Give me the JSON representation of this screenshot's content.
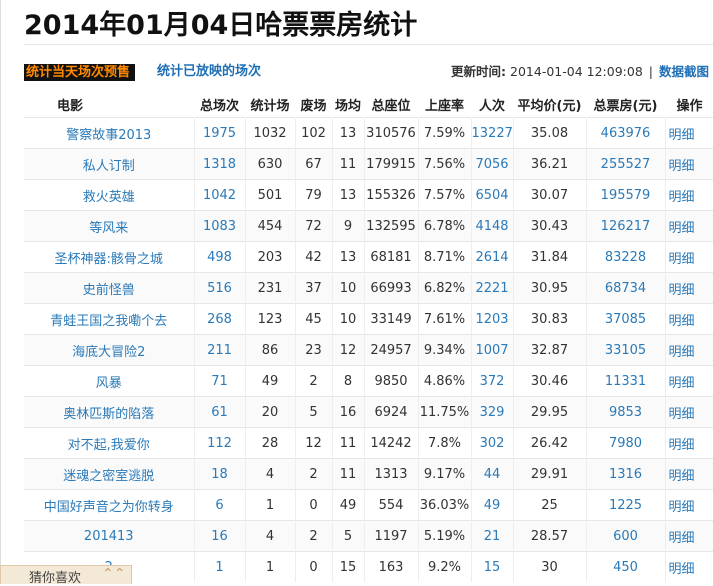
{
  "page": {
    "title": "2014年01月04日哈票票房统计"
  },
  "tabs": {
    "active": "统计当天场次预售",
    "other": "统计已放映的场次"
  },
  "update": {
    "label": "更新时间:",
    "time": "2014-01-04 12:09:08",
    "separator": "|",
    "screenshot_link": "数据截图"
  },
  "table": {
    "headers": [
      "电影",
      "总场次",
      "统计场",
      "废场",
      "场均",
      "总座位",
      "上座率",
      "人次",
      "平均价(元)",
      "总票房(元)",
      "操作"
    ],
    "rows": [
      [
        "警察故事2013",
        "1975",
        "1032",
        "102",
        "13",
        "310576",
        "7.59%",
        "13227",
        "35.08",
        "463976",
        "明细"
      ],
      [
        "私人订制",
        "1318",
        "630",
        "67",
        "11",
        "179915",
        "7.56%",
        "7056",
        "36.21",
        "255527",
        "明细"
      ],
      [
        "救火英雄",
        "1042",
        "501",
        "79",
        "13",
        "155326",
        "7.57%",
        "6504",
        "30.07",
        "195579",
        "明细"
      ],
      [
        "等风来",
        "1083",
        "454",
        "72",
        "9",
        "132595",
        "6.78%",
        "4148",
        "30.43",
        "126217",
        "明细"
      ],
      [
        "圣杯神器:骸骨之城",
        "498",
        "203",
        "42",
        "13",
        "68181",
        "8.71%",
        "2614",
        "31.84",
        "83228",
        "明细"
      ],
      [
        "史前怪兽",
        "516",
        "231",
        "37",
        "10",
        "66993",
        "6.82%",
        "2221",
        "30.95",
        "68734",
        "明细"
      ],
      [
        "青蛙王国之我嘞个去",
        "268",
        "123",
        "45",
        "10",
        "33149",
        "7.61%",
        "1203",
        "30.83",
        "37085",
        "明细"
      ],
      [
        "海底大冒险2",
        "211",
        "86",
        "23",
        "12",
        "24957",
        "9.34%",
        "1007",
        "32.87",
        "33105",
        "明细"
      ],
      [
        "风暴",
        "71",
        "49",
        "2",
        "8",
        "9850",
        "4.86%",
        "372",
        "30.46",
        "11331",
        "明细"
      ],
      [
        "奥林匹斯的陷落",
        "61",
        "20",
        "5",
        "16",
        "6924",
        "11.75%",
        "329",
        "29.95",
        "9853",
        "明细"
      ],
      [
        "对不起,我爱你",
        "112",
        "28",
        "12",
        "11",
        "14242",
        "7.8%",
        "302",
        "26.42",
        "7980",
        "明细"
      ],
      [
        "迷魂之密室逃脱",
        "18",
        "4",
        "2",
        "11",
        "1313",
        "9.17%",
        "44",
        "29.91",
        "1316",
        "明细"
      ],
      [
        "中国好声音之为你转身",
        "6",
        "1",
        "0",
        "49",
        "554",
        "36.03%",
        "49",
        "25",
        "1225",
        "明细"
      ],
      [
        "201413",
        "16",
        "4",
        "2",
        "5",
        "1197",
        "5.19%",
        "21",
        "28.57",
        "600",
        "明细"
      ],
      [
        "2",
        "1",
        "1",
        "0",
        "15",
        "163",
        "9.2%",
        "15",
        "30",
        "450",
        "明细"
      ]
    ]
  },
  "footer": {
    "guess_label": "猜你喜欢",
    "guess_icon": "double-chevron-up-icon"
  }
}
